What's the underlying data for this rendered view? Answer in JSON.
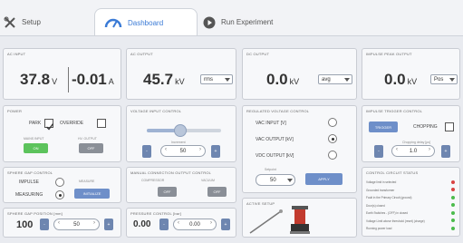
{
  "tabs": [
    {
      "label": "Setup",
      "icon": "tools-icon"
    },
    {
      "label": "Dashboard",
      "icon": "speedometer-icon"
    },
    {
      "label": "Run Experiment",
      "icon": "play-icon"
    }
  ],
  "readouts": {
    "ac_input": {
      "title": "AC INPUT",
      "voltage": "37.8",
      "voltage_unit": "V",
      "current": "-0.01",
      "current_unit": "A"
    },
    "ac_output": {
      "title": "AC OUTPUT",
      "value": "45.7",
      "unit": "kV",
      "mode": "rms"
    },
    "dc_output": {
      "title": "DC OUTPUT",
      "value": "0.0",
      "unit": "kV",
      "mode": "avg"
    },
    "impulse_peak": {
      "title": "IMPULSE PEAK OUTPUT",
      "value": "0.0",
      "unit": "kV",
      "mode": "Pos"
    }
  },
  "power": {
    "title": "POWER",
    "park_label": "PARK",
    "override_label": "OVERRIDE",
    "mains_label": "MAINS INPUT",
    "mains_state": "ON",
    "hv_label": "HV. OUTPUT",
    "hv_state": "OFF"
  },
  "voltage_input": {
    "title": "VOLTAGE INPUT CONTROL",
    "increment_label": "Increment",
    "minus": "-",
    "plus": "+",
    "value": "50",
    "slider_percent": 38
  },
  "regulated": {
    "title": "REGULATED VOLTAGE CONTROL",
    "options": [
      "VAC INPUT [V]",
      "VAC OUTPUT [kV]",
      "VDC OUTPUT [kV]"
    ],
    "selected": 1,
    "setpoint_label": "Setpoint",
    "setpoint": "50",
    "apply_label": "APPLY"
  },
  "impulse_trigger": {
    "title": "IMPULSE TRIGGER CONTROL",
    "trigger_label": "TRIGGER",
    "chopping_label": "CHOPPING",
    "delay_label": "Chopping delay [µs]",
    "value": "1.0",
    "minus": "-",
    "plus": "+"
  },
  "sphere_gap_ctrl": {
    "title": "SPHERE GAP CONTROL",
    "impulse_label": "IMPULSE",
    "measuring_label": "MEASURING",
    "top_label": "MEASURE",
    "button_label": "INITIALIZE"
  },
  "manual_conn": {
    "title": "MANUAL CONNECTION OUTPUT CONTROL",
    "compressor_label": "COMPRESSOR",
    "vacuum_label": "VACUUM",
    "compressor_state": "OFF",
    "vacuum_state": "OFF"
  },
  "sphere_gap_pos": {
    "title": "SPHERE GAP POSITION [mm]",
    "value": "100",
    "spin_value": "50",
    "minus": "-",
    "plus": "+"
  },
  "pressure": {
    "title": "PRESSURE CONTROL [bar]",
    "value": "0.00",
    "spin_value": "0.00",
    "minus": "-",
    "plus": "+"
  },
  "active_setup": {
    "title": "ACTIVE SETUP"
  },
  "control_status": {
    "title": "CONTROL CIRCUIT STATUS",
    "rows": [
      {
        "label": "Voltage limit in selected",
        "color": "#d94343"
      },
      {
        "label": "Grounded transformer",
        "color": "#d94343"
      },
      {
        "label": "Fault in the Primary Circuit (ground)",
        "color": "#4cbb4c"
      },
      {
        "label": "Door(s) closed",
        "color": "#4cbb4c"
      },
      {
        "label": "Earth Switches - (OFF) in closed",
        "color": "#4cbb4c"
      },
      {
        "label": "Voltage Limit above threshold (reset) (charge)",
        "color": "#4cbb4c"
      },
      {
        "label": "Running power load",
        "color": "#4cbb4c"
      }
    ]
  }
}
